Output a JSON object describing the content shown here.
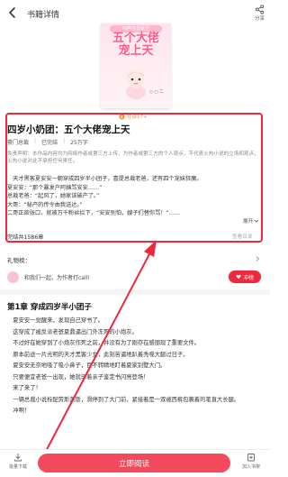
{
  "header": {
    "title": "书籍详情",
    "share_label": "分享"
  },
  "cover": {
    "top_text": "叫声你去就捏",
    "title_line1": "五个大佬",
    "title_line2": "宠上天",
    "author_mark": "○ ▢ 二"
  },
  "rating": {
    "text": "在读17+"
  },
  "book": {
    "title": "四岁小奶团：五个大佬宠上天",
    "genre": "豪门总裁",
    "status": "已完结",
    "word_count": "25万字"
  },
  "notice": "免责声明：本作品内容均为网络作者或第三方上传，为作者或第三方的个人观点，不代表火热小说的立场和观点，火热小说对此不承担任何责任。",
  "excerpt": {
    "lines": [
      "　天才黑客夏安安一朝穿成四岁半小团子，喜提总裁老爸，还有四个宠妹狂魔。",
      "夏安安：“那个暴发户阿姨骂安安……”",
      "总裁老爸：“起风了，她家该破产了。”",
      "大哥：“秘产的传令由我送达。”",
      "二哥正欲张口，就被万千粉丝拦下，“安安别怕，嫂子们替你骂！”……"
    ],
    "expand_label": "展开"
  },
  "chapters": {
    "total": "完结共1586章",
    "toc_label": "查看目录"
  },
  "gifts": {
    "label": "礼物榜："
  },
  "reader": {
    "text": "和我们一起，为作者打call!",
    "invite_label": "冲榜"
  },
  "chapter": {
    "title": "第1章 穿成四岁半小团子",
    "paragraphs": [
      "　夏安安一觉醒来，发现自己穿书了。",
      "　这穿成了被反派老爸夏鼎逼出门外冻死的小炮灰。",
      "　不过好在她穿到了小炮灰作死之前，并没有为了刚存在感丽现了重要文件。",
      "　原本前途一片光明的天才黑客少女，此刻苦逼地趴着秃噬大腿过日子。",
      "　夏安安无奈地吸了吸小鼻子，目不转睛地盯着夏家别墅大门。",
      "　只要便宜老爸一出现，她就毕着亲子鉴定书闪亮登场！",
      "　来了来了！",
      "　一辆总裁小说标配劳斯莱斯，滑停到了大门前，紧接着是一双被西裤包裹着的笔直大长腿。",
      "　冲啊！"
    ]
  },
  "bottom": {
    "download_label": "批量下载",
    "read_label": "立即阅读",
    "shelf_label": "加入书架"
  },
  "colors": {
    "accent": "#f0283c",
    "button": "#f24a5c"
  }
}
